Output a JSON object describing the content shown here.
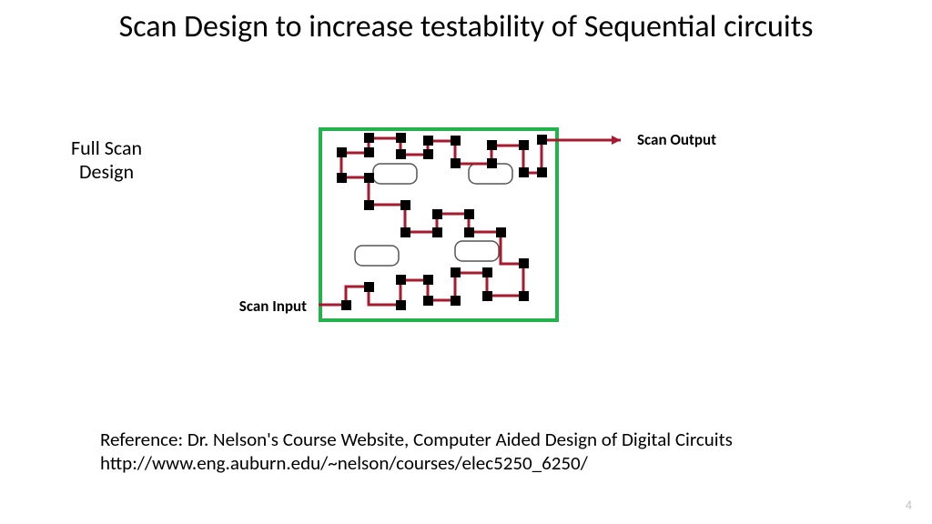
{
  "title": "Scan Design to increase testability of Sequential circuits",
  "labels": {
    "full_scan_l1": "Full Scan",
    "full_scan_l2": "Design",
    "scan_input": "Scan Input",
    "scan_output": "Scan Output"
  },
  "reference": {
    "line1": "Reference: Dr. Nelson's Course Website, Computer Aided Design of Digital Circuits",
    "line2": "http://www.eng.auburn.edu/~nelson/courses/elec5250_6250/"
  },
  "page_number": "4",
  "diagram": {
    "border_color": "#24B24C",
    "path_color": "#A6192E",
    "node_color": "#000000",
    "empty_fill": "#ffffff"
  }
}
